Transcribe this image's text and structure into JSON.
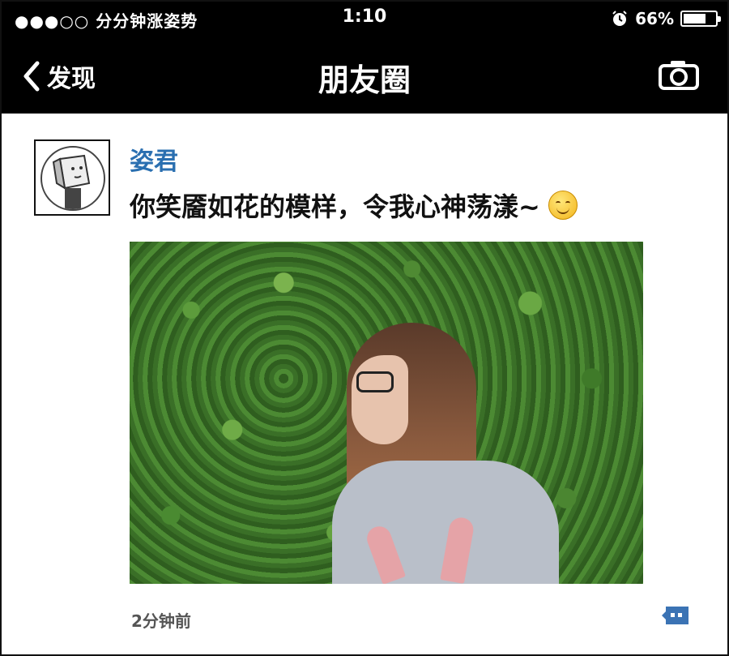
{
  "status_bar": {
    "carrier": "●●●○○ 分分钟涨姿势",
    "time": "1:10",
    "battery": "66%",
    "battery_level": 0.66
  },
  "nav": {
    "back_label": "发现",
    "title": "朋友圈"
  },
  "post": {
    "username": "姿君",
    "text": "你笑靥如花的模样，令我心神荡漾~",
    "timestamp": "2分钟前"
  },
  "colors": {
    "bar_background": "#000000",
    "username": "#2a6fb0",
    "comment_icon": "#3b73b4"
  },
  "icons": [
    "chevron-left-icon",
    "camera-icon",
    "alarm-icon",
    "battery-icon",
    "smile-emoji-icon",
    "comment-icon"
  ]
}
